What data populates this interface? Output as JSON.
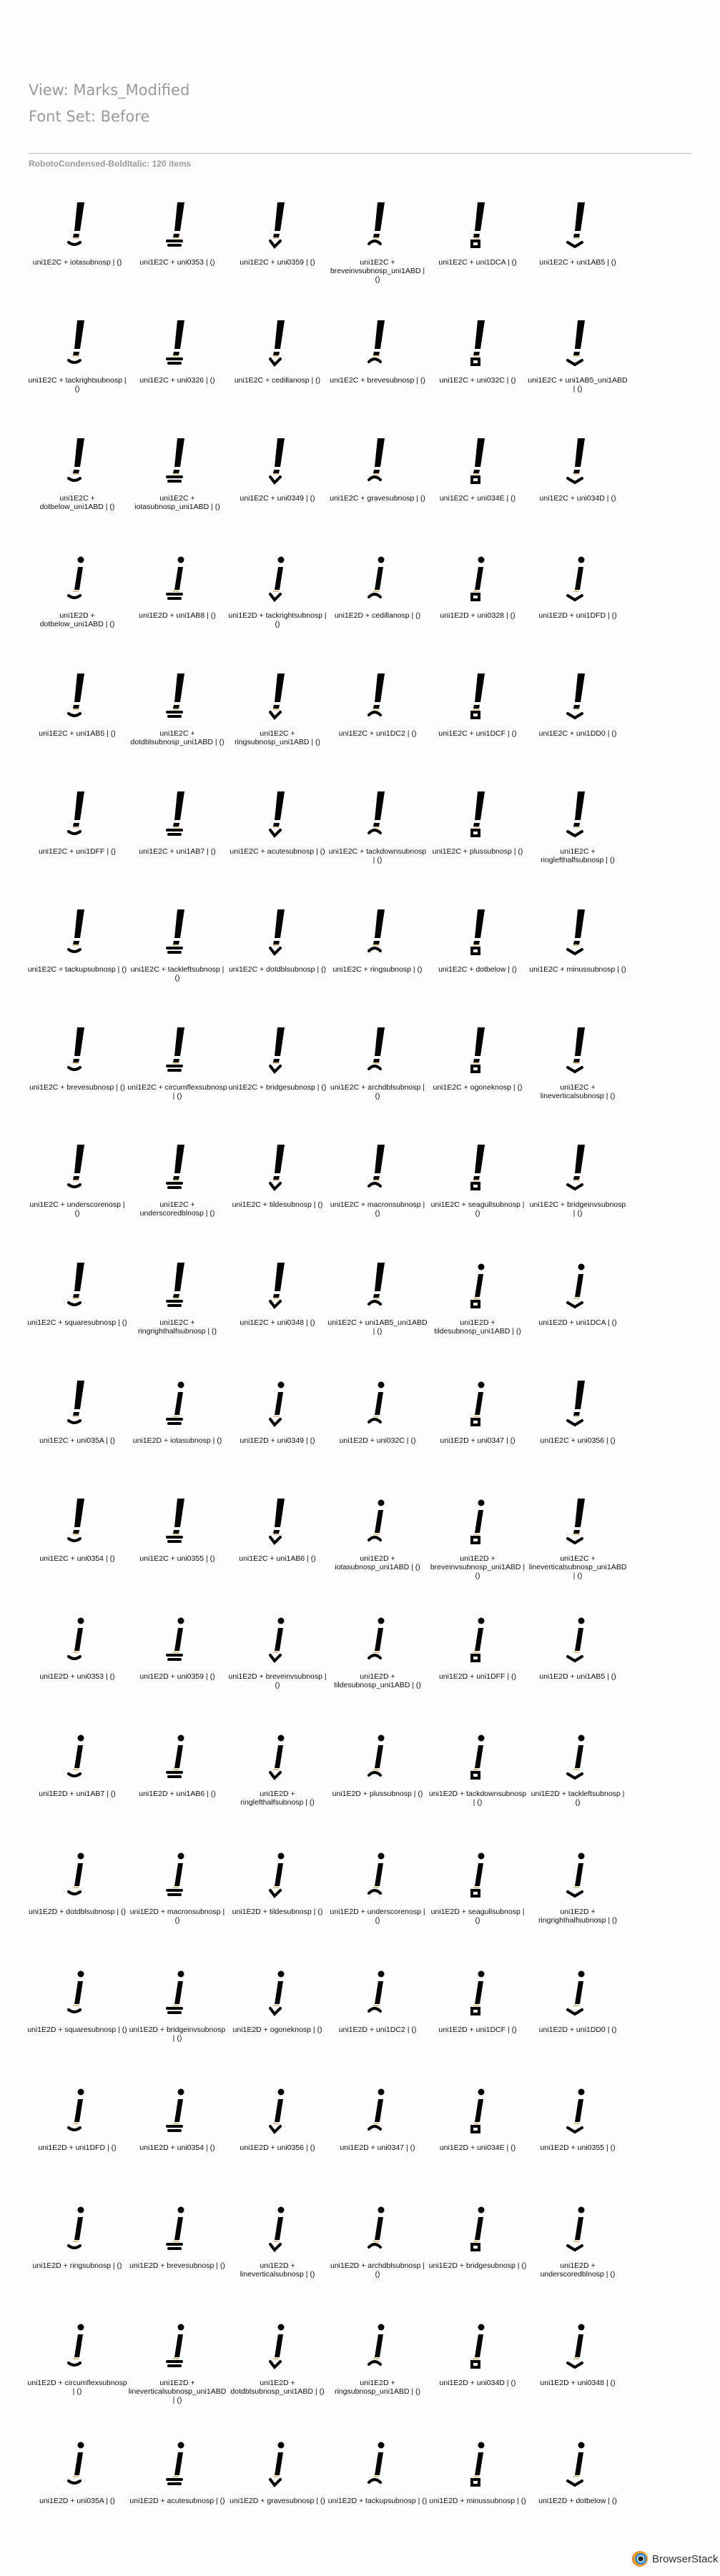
{
  "header": {
    "view": "View: Marks_Modified",
    "fontset": "Font Set: Before"
  },
  "subtitle": "RobotoCondensed-BoldItalic: 120 items",
  "brand": "BrowserStack",
  "items": [
    "uni1E2C + iotasubnosp | ()",
    "uni1E2C + uni0353 | ()",
    "uni1E2C + uni0359 | ()",
    "uni1E2C + breveinvsubnosp_uni1ABD | ()",
    "uni1E2C + uni1DCA | ()",
    "uni1E2C + uni1AB5 | ()",
    "uni1E2C + tackrightsubnosp | ()",
    "uni1E2C + uni0326 | ()",
    "uni1E2C + cedillanosp | ()",
    "uni1E2C + brevesubnosp | ()",
    "uni1E2C + uni032C | ()",
    "uni1E2C + uni1AB5_uni1ABD | ()",
    "uni1E2C + dotbelow_uni1ABD | ()",
    "uni1E2C + iotasubnosp_uni1ABD | ()",
    "uni1E2C + uni0349 | ()",
    "uni1E2C + gravesubnosp | ()",
    "uni1E2C + uni034E | ()",
    "uni1E2C + uni034D | ()",
    "uni1E2D + dotbelow_uni1ABD | ()",
    "uni1E2D + uni1AB8 | ()",
    "uni1E2D + tackrightsubnosp | ()",
    "uni1E2D + cedillanosp | ()",
    "uni1E2D + uni0328 | ()",
    "uni1E2D + uni1DFD | ()",
    "uni1E2C + uni1AB5 | ()",
    "uni1E2C + dotdblsubnosp_uni1ABD | ()",
    "uni1E2C + ringsubnosp_uni1ABD | ()",
    "uni1E2C + uni1DC2 | ()",
    "uni1E2C + uni1DCF | ()",
    "uni1E2C + uni1DD0 | ()",
    "uni1E2C + uni1DFF | ()",
    "uni1E2C + uni1AB7 | ()",
    "uni1E2C + acutesubnosp | ()",
    "uni1E2C + tackdownsubnosp | ()",
    "uni1E2C + plussubnosp | ()",
    "uni1E2C + ringlefthalfsubnosp | ()",
    "uni1E2C + tackupsubnosp | ()",
    "uni1E2C + tackleftsubnosp | ()",
    "uni1E2C + dotdblsubnosp | ()",
    "uni1E2C + ringsubnosp | ()",
    "uni1E2C + dotbelow | ()",
    "uni1E2C + minussubnosp | ()",
    "uni1E2C + brevesubnosp | ()",
    "uni1E2C + circumflexsubnosp | ()",
    "uni1E2C + bridgesubnosp | ()",
    "uni1E2C + archdblsubnosp | ()",
    "uni1E2C + ogoneknosp | ()",
    "uni1E2C + lineverticalsubnosp | ()",
    "uni1E2C + underscorenosp | ()",
    "uni1E2C + underscoredblnosp | ()",
    "uni1E2C + tildesubnosp | ()",
    "uni1E2C + macronsubnosp | ()",
    "uni1E2C + seagullsubnosp | ()",
    "uni1E2C + bridgeinvsubnosp | ()",
    "uni1E2C + squaresubnosp | ()",
    "uni1E2C + ringrighthalfsubnosp | ()",
    "uni1E2C + uni0348 | ()",
    "uni1E2C + uni1AB5_uni1ABD | ()",
    "uni1E2D + tildesubnosp_uni1ABD | ()",
    "uni1E2D + uni1DCA | ()",
    "uni1E2C + uni035A | ()",
    "uni1E2D + iotasubnosp | ()",
    "uni1E2D + uni0349 | ()",
    "uni1E2D + uni032C | ()",
    "uni1E2D + uni0347 | ()",
    "uni1E2C + uni0356 | ()",
    "uni1E2C + uni0354 | ()",
    "uni1E2C + uni0355 | ()",
    "uni1E2C + uni1AB6 | ()",
    "uni1E2D + iotasubnosp_uni1ABD | ()",
    "uni1E2D + breveinvsubnosp_uni1ABD | ()",
    "uni1E2C + lineverticalsubnosp_uni1ABD | ()",
    "uni1E2D + uni0353 | ()",
    "uni1E2D + uni0359 | ()",
    "uni1E2D + breveinvsubnosp | ()",
    "uni1E2D + tildesubnosp_uni1ABD | ()",
    "uni1E2D + uni1DFF | ()",
    "uni1E2D + uni1AB5 | ()",
    "uni1E2D + uni1AB7 | ()",
    "uni1E2D + uni1AB6 | ()",
    "uni1E2D + ringlefthalfsubnosp | ()",
    "uni1E2D + plussubnosp | ()",
    "uni1E2D + tackdownsubnosp | ()",
    "uni1E2D + tackleftsubnosp | ()",
    "uni1E2D + dotdblsubnosp | ()",
    "uni1E2D + macronsubnosp | ()",
    "uni1E2D + tildesubnosp | ()",
    "uni1E2D + underscorenosp | ()",
    "uni1E2D + seagullsubnosp | ()",
    "uni1E2D + ringrighthalfsubnosp | ()",
    "uni1E2D + squaresubnosp | ()",
    "uni1E2D + bridgeinvsubnosp | ()",
    "uni1E2D + ogoneknosp | ()",
    "uni1E2D + uni1DC2 | ()",
    "uni1E2D + uni1DCF | ()",
    "uni1E2D + uni1DD0 | ()",
    "uni1E2D + uni1DFD | ()",
    "uni1E2D + uni0354 | ()",
    "uni1E2D + uni0356 | ()",
    "uni1E2D + uni0347 | ()",
    "uni1E2D + uni034E | ()",
    "uni1E2D + uni0355 | ()",
    "uni1E2D + ringsubnosp | ()",
    "uni1E2D + brevesubnosp | ()",
    "uni1E2D + lineverticalsubnosp | ()",
    "uni1E2D + archdblsubnosp | ()",
    "uni1E2D + bridgesubnosp | ()",
    "uni1E2D + underscoredblnosp | ()",
    "uni1E2D + circumflexsubnosp | ()",
    "uni1E2D + lineverticalsubnosp_uni1ABD | ()",
    "uni1E2D + dotdblsubnosp_uni1ABD | ()",
    "uni1E2D + ringsubnosp_uni1ABD | ()",
    "uni1E2D + uni034D | ()",
    "uni1E2D + uni0348 | ()",
    "uni1E2D + uni035A | ()",
    "uni1E2D + acutesubnosp | ()",
    "uni1E2D + gravesubnosp | ()",
    "uni1E2D + tackupsubnosp | ()",
    "uni1E2D + minussubnosp | ()",
    "uni1E2D + dotbelow | ()"
  ]
}
